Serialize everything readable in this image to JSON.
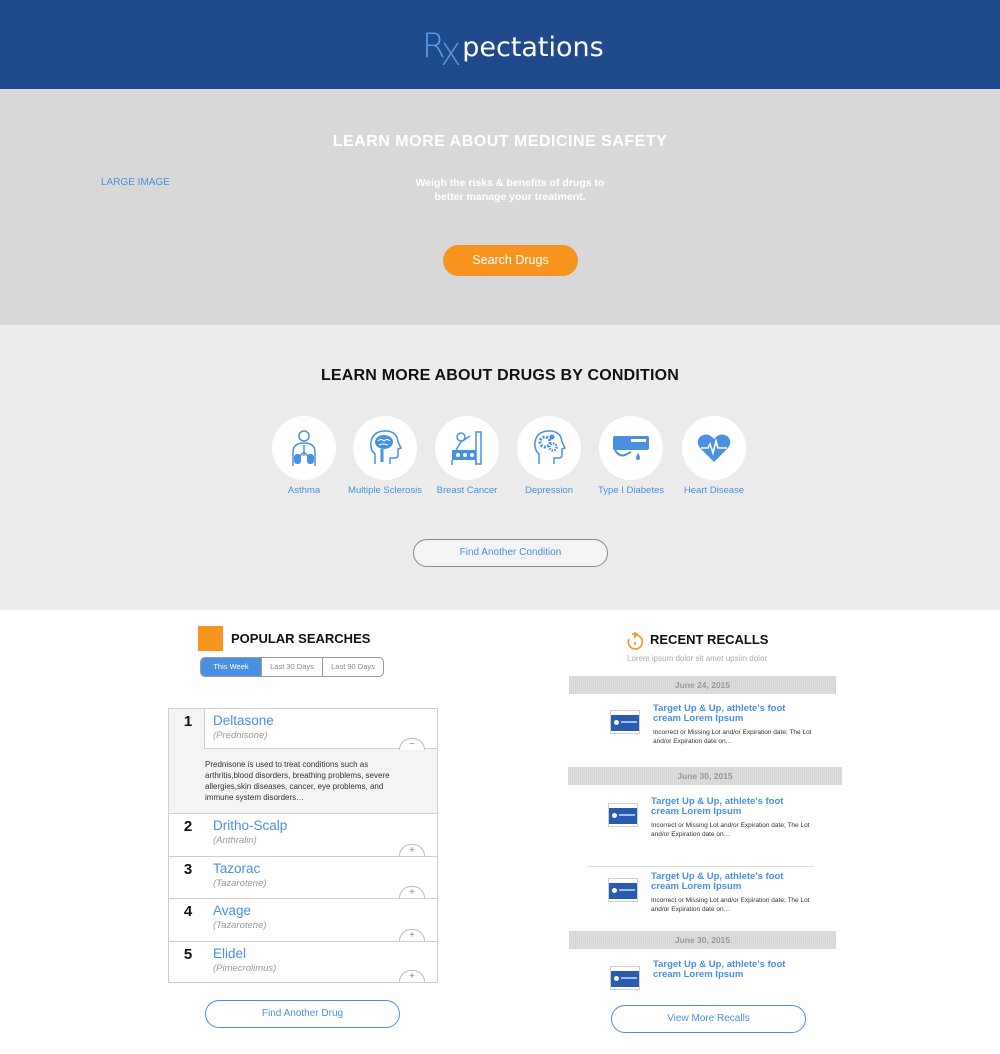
{
  "header": {
    "logo_rx": "R",
    "logo_x": "X",
    "logo_text": "pectations",
    "bg_color": "#1f4a8b"
  },
  "hero": {
    "image_label": "LARGE IMAGE",
    "title": "LEARN MORE ABOUT MEDICINE SAFETY",
    "subtitle": "Weigh the risks & benefits of drugs to better manage your treatment.",
    "button": "Search Drugs",
    "button_color": "#f7941d"
  },
  "conditions": {
    "title": "LEARN MORE ABOUT DRUGS BY CONDITION",
    "items": [
      {
        "label": "Asthma",
        "icon": "lungs-icon"
      },
      {
        "label": "Multiple Sclerosis",
        "icon": "brain-head-icon"
      },
      {
        "label": "Breast Cancer",
        "icon": "patient-bed-icon"
      },
      {
        "label": "Depression",
        "icon": "head-gears-icon"
      },
      {
        "label": "Type I Diabetes",
        "icon": "glucose-meter-icon"
      },
      {
        "label": "Heart Disease",
        "icon": "heart-pulse-icon"
      }
    ],
    "button": "Find Another Condition",
    "accent": "#4a90e2"
  },
  "popular": {
    "title": "POPULAR SEARCHES",
    "tabs": [
      "This Week",
      "Last 30 Days",
      "Last 90 Days"
    ],
    "active_tab": "This Week",
    "drugs": [
      {
        "rank": "1",
        "name": "Deltasone",
        "generic": "(Prednisone)",
        "toggle": "−",
        "description": "Prednisone is used to treat conditions such as arthritis,blood disorders, breathing problems, severe allergies,skin diseases, cancer, eye problems, and immune system disorders…"
      },
      {
        "rank": "2",
        "name": "Dritho-Scalp",
        "generic": "(Anthralin)",
        "toggle": "+"
      },
      {
        "rank": "3",
        "name": "Tazorac",
        "generic": "(Tazarotene)",
        "toggle": "+"
      },
      {
        "rank": "4",
        "name": "Avage",
        "generic": "(Tazarotene)",
        "toggle": "+"
      },
      {
        "rank": "5",
        "name": "Elidel",
        "generic": "(Pimecrolimus)",
        "toggle": "+"
      }
    ],
    "button": "Find Another Drug"
  },
  "recalls": {
    "title": "RECENT RECALLS",
    "subtitle": "Lorem ipsum dolor sit amet upsim dolor",
    "dates": [
      "June 24, 2015",
      "June 30, 2015",
      "June 30, 2015"
    ],
    "items": [
      {
        "title": "Target Up & Up, athlete's foot cream Lorem Ipsum",
        "desc": "Incorrect or Missing Lot and/or Expiration date; The Lot and/or Expiration date on…"
      },
      {
        "title": "Target Up & Up, athlete's foot cream Lorem Ipsum",
        "desc": "Incorrect or Missing Lot and/or Expiration date; The Lot and/or Expiration date on…"
      },
      {
        "title": "Target Up & Up, athlete's foot cream Lorem Ipsum",
        "desc": "Incorrect or Missing Lot and/or Expiration date; The Lot and/or Expiration date on…"
      },
      {
        "title": "Target Up & Up, athlete's foot cream Lorem Ipsum",
        "desc": ""
      }
    ],
    "button": "View More Recalls"
  }
}
